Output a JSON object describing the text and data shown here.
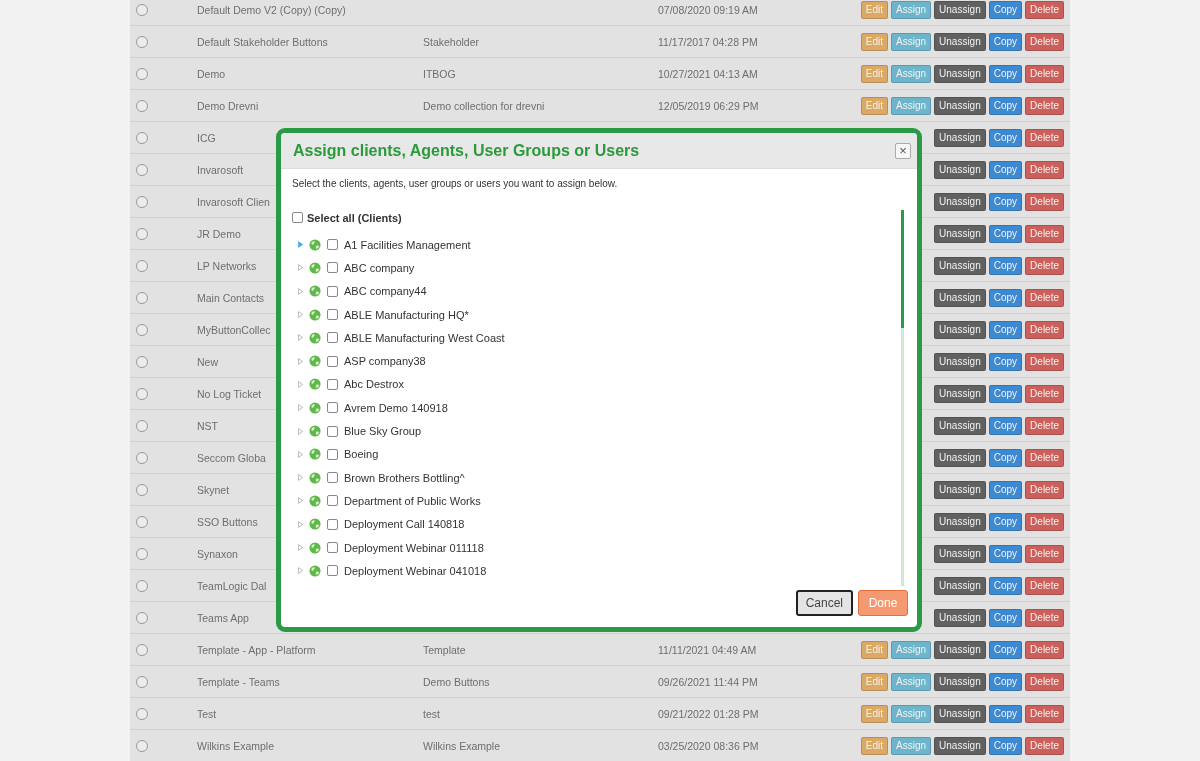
{
  "table": {
    "rows": [
      {
        "name": "Default Demo V2 (Copy) (Copy)",
        "selected": false,
        "date": "07/08/2020 09:19 AM",
        "buttons": [
          {
            "label": "Edit",
            "kind": "edit"
          },
          {
            "label": "Assign",
            "kind": "assign"
          },
          {
            "label": "Unassign",
            "kind": "unassign"
          },
          {
            "label": "Copy",
            "kind": "copy"
          },
          {
            "label": "Delete",
            "kind": "delete"
          }
        ]
      },
      {
        "name": "Default Stakeholder Buttons",
        "selected": false,
        "description": "Stakeholder",
        "date": "11/17/2017 04:28 PM",
        "buttons": [
          {
            "label": "Edit",
            "kind": "edit"
          },
          {
            "label": "Assign",
            "kind": "assign"
          },
          {
            "label": "Unassign",
            "kind": "unassign"
          },
          {
            "label": "Copy",
            "kind": "copy"
          },
          {
            "label": "Delete",
            "kind": "delete"
          }
        ]
      },
      {
        "name": "Demo",
        "selected": false,
        "description": "ITBOG",
        "date": "10/27/2021 04:13 AM",
        "buttons": [
          {
            "label": "Edit",
            "kind": "edit"
          },
          {
            "label": "Assign",
            "kind": "assign"
          },
          {
            "label": "Unassign",
            "kind": "unassign"
          },
          {
            "label": "Copy",
            "kind": "copy"
          },
          {
            "label": "Delete",
            "kind": "delete"
          }
        ]
      },
      {
        "name": "Demo Drevni",
        "selected": false,
        "description": "Demo collection for drevni",
        "date": "12/05/2019 06:29 PM",
        "buttons": [
          {
            "label": "Edit",
            "kind": "edit"
          },
          {
            "label": "Assign",
            "kind": "assign"
          },
          {
            "label": "Unassign",
            "kind": "unassign"
          },
          {
            "label": "Copy",
            "kind": "copy"
          },
          {
            "label": "Delete",
            "kind": "delete"
          }
        ]
      },
      {
        "name": "ICG",
        "selected": false,
        "buttons": [
          {
            "label": "Unassign",
            "kind": "unassign"
          },
          {
            "label": "Copy",
            "kind": "copy"
          },
          {
            "label": "Delete",
            "kind": "delete"
          }
        ]
      },
      {
        "name": "Invarosoft",
        "selected": false,
        "buttons": [
          {
            "label": "Unassign",
            "kind": "unassign"
          },
          {
            "label": "Copy",
            "kind": "copy"
          },
          {
            "label": "Delete",
            "kind": "delete"
          }
        ]
      },
      {
        "name": "Invarosoft Clien",
        "selected": false,
        "buttons": [
          {
            "label": "Unassign",
            "kind": "unassign"
          },
          {
            "label": "Copy",
            "kind": "copy"
          },
          {
            "label": "Delete",
            "kind": "delete"
          }
        ]
      },
      {
        "name": "JR Demo",
        "selected": false,
        "buttons": [
          {
            "label": "Unassign",
            "kind": "unassign"
          },
          {
            "label": "Copy",
            "kind": "copy"
          },
          {
            "label": "Delete",
            "kind": "delete"
          }
        ]
      },
      {
        "name": "LP Networks",
        "selected": false,
        "buttons": [
          {
            "label": "Unassign",
            "kind": "unassign"
          },
          {
            "label": "Copy",
            "kind": "copy"
          },
          {
            "label": "Delete",
            "kind": "delete"
          }
        ]
      },
      {
        "name": "Main Contacts",
        "selected": false,
        "buttons": [
          {
            "label": "Unassign",
            "kind": "unassign"
          },
          {
            "label": "Copy",
            "kind": "copy"
          },
          {
            "label": "Delete",
            "kind": "delete"
          }
        ]
      },
      {
        "name": "MyButtonCollec",
        "selected": false,
        "buttons": [
          {
            "label": "Unassign",
            "kind": "unassign"
          },
          {
            "label": "Copy",
            "kind": "copy"
          },
          {
            "label": "Delete",
            "kind": "delete"
          }
        ]
      },
      {
        "name": "New",
        "selected": false,
        "buttons": [
          {
            "label": "Unassign",
            "kind": "unassign"
          },
          {
            "label": "Copy",
            "kind": "copy"
          },
          {
            "label": "Delete",
            "kind": "delete"
          }
        ]
      },
      {
        "name": "No Log Ticket",
        "selected": false,
        "buttons": [
          {
            "label": "Unassign",
            "kind": "unassign"
          },
          {
            "label": "Copy",
            "kind": "copy"
          },
          {
            "label": "Delete",
            "kind": "delete"
          }
        ]
      },
      {
        "name": "NST",
        "selected": false,
        "buttons": [
          {
            "label": "Unassign",
            "kind": "unassign"
          },
          {
            "label": "Copy",
            "kind": "copy"
          },
          {
            "label": "Delete",
            "kind": "delete"
          }
        ]
      },
      {
        "name": "Seccom Globa",
        "selected": false,
        "buttons": [
          {
            "label": "Unassign",
            "kind": "unassign"
          },
          {
            "label": "Copy",
            "kind": "copy"
          },
          {
            "label": "Delete",
            "kind": "delete"
          }
        ]
      },
      {
        "name": "Skynet",
        "selected": false,
        "buttons": [
          {
            "label": "Unassign",
            "kind": "unassign"
          },
          {
            "label": "Copy",
            "kind": "copy"
          },
          {
            "label": "Delete",
            "kind": "delete"
          }
        ]
      },
      {
        "name": "SSO Buttons",
        "selected": false,
        "buttons": [
          {
            "label": "Unassign",
            "kind": "unassign"
          },
          {
            "label": "Copy",
            "kind": "copy"
          },
          {
            "label": "Delete",
            "kind": "delete"
          }
        ]
      },
      {
        "name": "Synaxon",
        "selected": false,
        "buttons": [
          {
            "label": "Unassign",
            "kind": "unassign"
          },
          {
            "label": "Copy",
            "kind": "copy"
          },
          {
            "label": "Delete",
            "kind": "delete"
          }
        ]
      },
      {
        "name": "TeamLogic Dal",
        "selected": false,
        "buttons": [
          {
            "label": "Unassign",
            "kind": "unassign"
          },
          {
            "label": "Copy",
            "kind": "copy"
          },
          {
            "label": "Delete",
            "kind": "delete"
          }
        ]
      },
      {
        "name": "Teams App",
        "selected": false,
        "buttons": [
          {
            "label": "Unassign",
            "kind": "unassign"
          },
          {
            "label": "Copy",
            "kind": "copy"
          },
          {
            "label": "Delete",
            "kind": "delete"
          }
        ]
      },
      {
        "name": "Template - App - Platform",
        "selected": false,
        "description": "Template",
        "date": "11/11/2021 04:49 AM",
        "buttons": [
          {
            "label": "Edit",
            "kind": "edit"
          },
          {
            "label": "Assign",
            "kind": "assign"
          },
          {
            "label": "Unassign",
            "kind": "unassign"
          },
          {
            "label": "Copy",
            "kind": "copy"
          },
          {
            "label": "Delete",
            "kind": "delete"
          }
        ]
      },
      {
        "name": "Template - Teams",
        "selected": false,
        "description": "Demo Buttons",
        "date": "09/26/2021 11:44 PM",
        "buttons": [
          {
            "label": "Edit",
            "kind": "edit"
          },
          {
            "label": "Assign",
            "kind": "assign"
          },
          {
            "label": "Unassign",
            "kind": "unassign"
          },
          {
            "label": "Copy",
            "kind": "copy"
          },
          {
            "label": "Delete",
            "kind": "delete"
          }
        ]
      },
      {
        "name": "Test",
        "selected": false,
        "description": "test",
        "date": "09/21/2022 01:28 PM",
        "buttons": [
          {
            "label": "Edit",
            "kind": "edit"
          },
          {
            "label": "Assign",
            "kind": "assign"
          },
          {
            "label": "Unassign",
            "kind": "unassign"
          },
          {
            "label": "Copy",
            "kind": "copy"
          },
          {
            "label": "Delete",
            "kind": "delete"
          }
        ]
      },
      {
        "name": "Wilkins Example",
        "selected": false,
        "description": "Wilkins Example",
        "date": "03/25/2020 08:36 PM",
        "buttons": [
          {
            "label": "Edit",
            "kind": "edit"
          },
          {
            "label": "Assign",
            "kind": "assign"
          },
          {
            "label": "Unassign",
            "kind": "unassign"
          },
          {
            "label": "Copy",
            "kind": "copy"
          },
          {
            "label": "Delete",
            "kind": "delete"
          }
        ]
      }
    ]
  },
  "dialog": {
    "title": "Assign clients, Agents, User Groups or Users",
    "close": "×",
    "instructions": "Select the clients, agents, user groups or users you want to assign below.",
    "select_all": {
      "label": "Select all (Clients)",
      "checked": false
    },
    "clients": [
      {
        "name": "A1 Facilities Management",
        "checked": false,
        "hovered": true
      },
      {
        "name": "ABC company",
        "checked": false,
        "hovered": false
      },
      {
        "name": "ABC company44",
        "checked": false,
        "hovered": false
      },
      {
        "name": "ABLE Manufacturing HQ*",
        "checked": false,
        "hovered": false
      },
      {
        "name": "ABLE Manufacturing West Coast",
        "checked": false,
        "hovered": false
      },
      {
        "name": "ASP company38",
        "checked": false,
        "hovered": false
      },
      {
        "name": "Abc Destrox",
        "checked": false,
        "hovered": false
      },
      {
        "name": "Avrem Demo 140918",
        "checked": false,
        "hovered": false
      },
      {
        "name": "Blue Sky Group",
        "checked": false,
        "hovered": false
      },
      {
        "name": "Boeing",
        "checked": false,
        "hovered": false
      },
      {
        "name": "Brown Brothers Bottling^",
        "checked": false,
        "hovered": false
      },
      {
        "name": "Department of Public Works",
        "checked": false,
        "hovered": false
      },
      {
        "name": "Deployment Call 140818",
        "checked": false,
        "hovered": false
      },
      {
        "name": "Deployment Webinar 011118",
        "checked": false,
        "hovered": false
      },
      {
        "name": "Deployment Webinar 041018",
        "checked": false,
        "hovered": false
      }
    ],
    "buttons": [
      {
        "label": "Cancel",
        "kind": "cancel",
        "disabled": false
      },
      {
        "label": "Done",
        "kind": "done",
        "disabled": true
      }
    ]
  }
}
